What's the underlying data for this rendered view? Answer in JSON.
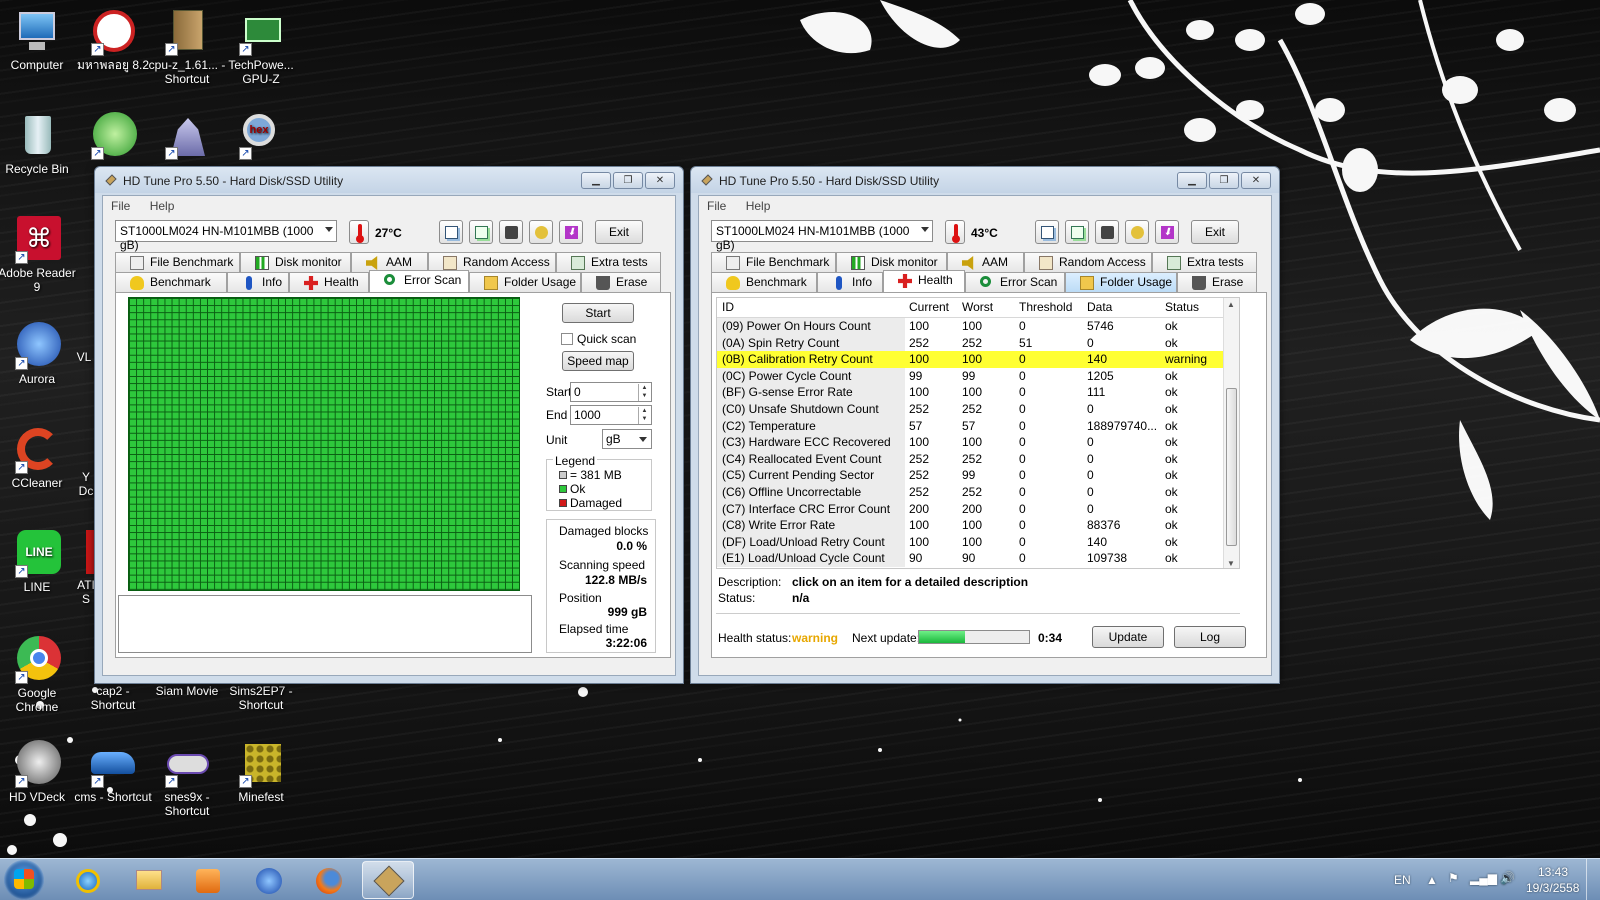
{
  "desktop": {
    "icons": [
      {
        "label": "Computer"
      },
      {
        "label": "มหาพลอยู 8.2"
      },
      {
        "label": "cpu-z_1.61... - Shortcut"
      },
      {
        "label": "TechPowe... GPU-Z"
      },
      {
        "label": "Recycle Bin"
      },
      {
        "label": "Adobe Reader 9"
      },
      {
        "label": "Aurora"
      },
      {
        "label": "CCleaner"
      },
      {
        "label": "LINE"
      },
      {
        "label": "Google Chrome"
      },
      {
        "label": "HD VDeck"
      },
      {
        "label": "cap2 - Shortcut"
      },
      {
        "label": "cms - Shortcut"
      },
      {
        "label": "Siam Movie"
      },
      {
        "label": "snes9x - Shortcut"
      },
      {
        "label": "Sims2EP7 - Shortcut"
      },
      {
        "label": "Minefest"
      },
      {
        "label": "VL"
      },
      {
        "label": "Y Dc"
      },
      {
        "label": "ATI S"
      }
    ]
  },
  "left_window": {
    "title": "HD Tune Pro 5.50 - Hard Disk/SSD Utility",
    "menu": [
      "File",
      "Help"
    ],
    "drive": "ST1000LM024 HN-M101MBB (1000 gB)",
    "temperature": "27°C",
    "exit_label": "Exit",
    "tabs_row1": [
      "File Benchmark",
      "Disk monitor",
      "AAM",
      "Random Access",
      "Extra tests"
    ],
    "tabs_row2": [
      "Benchmark",
      "Info",
      "Health",
      "Error Scan",
      "Folder Usage",
      "Erase"
    ],
    "active_tab": "Error Scan",
    "start_label": "Start",
    "quick_scan_label": "Quick scan",
    "speed_map_label": "Speed map",
    "start_field_label": "Start",
    "start_value": "0",
    "end_field_label": "End",
    "end_value": "1000",
    "unit_label": "Unit",
    "unit_value": "gB",
    "legend_title": "Legend",
    "legend_block": "= 381 MB",
    "legend_ok": "Ok",
    "legend_damaged": "Damaged",
    "damaged_blocks_label": "Damaged blocks",
    "damaged_blocks_value": "0.0 %",
    "scanning_speed_label": "Scanning speed",
    "scanning_speed_value": "122.8 MB/s",
    "position_label": "Position",
    "position_value": "999 gB",
    "elapsed_label": "Elapsed time",
    "elapsed_value": "3:22:06",
    "colors": {
      "ok": "#2ec83c",
      "damaged": "#d11919",
      "grid_line": "#0a5d12"
    }
  },
  "right_window": {
    "title": "HD Tune Pro 5.50 - Hard Disk/SSD Utility",
    "menu": [
      "File",
      "Help"
    ],
    "drive": "ST1000LM024 HN-M101MBB (1000 gB)",
    "temperature": "43°C",
    "exit_label": "Exit",
    "tabs_row1": [
      "File Benchmark",
      "Disk monitor",
      "AAM",
      "Random Access",
      "Extra tests"
    ],
    "tabs_row2": [
      "Benchmark",
      "Info",
      "Health",
      "Error Scan",
      "Folder Usage",
      "Erase"
    ],
    "active_tab": "Health",
    "columns": [
      "ID",
      "Current",
      "Worst",
      "Threshold",
      "Data",
      "Status"
    ],
    "rows": [
      [
        "(09) Power On Hours Count",
        "100",
        "100",
        "0",
        "5746",
        "ok"
      ],
      [
        "(0A) Spin Retry Count",
        "252",
        "252",
        "51",
        "0",
        "ok"
      ],
      [
        "(0B) Calibration Retry Count",
        "100",
        "100",
        "0",
        "140",
        "warning"
      ],
      [
        "(0C) Power Cycle Count",
        "99",
        "99",
        "0",
        "1205",
        "ok"
      ],
      [
        "(BF) G-sense Error Rate",
        "100",
        "100",
        "0",
        "111",
        "ok"
      ],
      [
        "(C0) Unsafe Shutdown Count",
        "252",
        "252",
        "0",
        "0",
        "ok"
      ],
      [
        "(C2) Temperature",
        "57",
        "57",
        "0",
        "188979740...",
        "ok"
      ],
      [
        "(C3) Hardware ECC Recovered",
        "100",
        "100",
        "0",
        "0",
        "ok"
      ],
      [
        "(C4) Reallocated Event Count",
        "252",
        "252",
        "0",
        "0",
        "ok"
      ],
      [
        "(C5) Current Pending Sector",
        "252",
        "99",
        "0",
        "0",
        "ok"
      ],
      [
        "(C6) Offline Uncorrectable",
        "252",
        "252",
        "0",
        "0",
        "ok"
      ],
      [
        "(C7) Interface CRC Error Count",
        "200",
        "200",
        "0",
        "0",
        "ok"
      ],
      [
        "(C8) Write Error Rate",
        "100",
        "100",
        "0",
        "88376",
        "ok"
      ],
      [
        "(DF) Load/Unload Retry Count",
        "100",
        "100",
        "0",
        "140",
        "ok"
      ],
      [
        "(E1) Load/Unload Cycle Count",
        "90",
        "90",
        "0",
        "109738",
        "ok"
      ]
    ],
    "highlight_row": 2,
    "description_label": "Description:",
    "description_value": "click on an item for a detailed description",
    "status_label": "Status:",
    "status_value": "n/a",
    "health_status_label": "Health status:",
    "health_status_value": "warning",
    "next_update_label": "Next update:",
    "next_update_progress": 0.42,
    "next_update_value": "0:34",
    "update_label": "Update",
    "log_label": "Log",
    "colors": {
      "warning_text": "#e7a700",
      "highlight": "#ffff33"
    }
  },
  "taskbar": {
    "language": "EN",
    "time": "13:43",
    "date": "19/3/2558"
  }
}
